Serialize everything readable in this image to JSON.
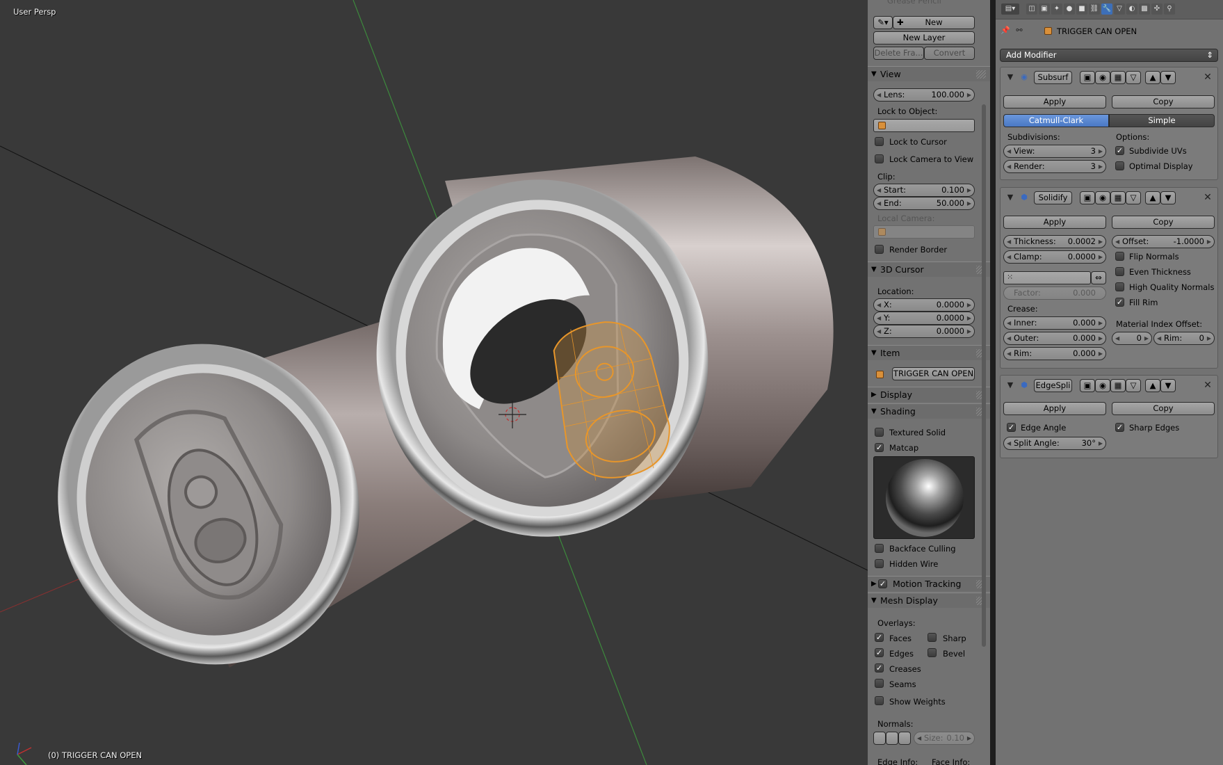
{
  "viewport": {
    "view_label": "User Persp",
    "object_label": "(0) TRIGGER CAN OPEN"
  },
  "tool_panel": {
    "grease_pencil": {
      "label": "Grease Pencil",
      "new": "New",
      "new_layer": "New Layer",
      "delete_frame": "Delete Fra...",
      "convert": "Convert"
    },
    "view": {
      "title": "View",
      "lens_label": "Lens:",
      "lens_value": "100.000",
      "lock_to_object": "Lock to Object:",
      "lock_to_cursor": "Lock to Cursor",
      "lock_camera": "Lock Camera to View",
      "clip": "Clip:",
      "start_label": "Start:",
      "start_value": "0.100",
      "end_label": "End:",
      "end_value": "50.000",
      "local_camera": "Local Camera:",
      "render_border": "Render Border"
    },
    "cursor": {
      "title": "3D Cursor",
      "location": "Location:",
      "x_label": "X:",
      "x_value": "0.0000",
      "y_label": "Y:",
      "y_value": "0.0000",
      "z_label": "Z:",
      "z_value": "0.0000"
    },
    "item": {
      "title": "Item",
      "name": "TRIGGER CAN OPEN"
    },
    "display": {
      "title": "Display"
    },
    "shading": {
      "title": "Shading",
      "textured_solid": "Textured Solid",
      "textured_solid_checked": false,
      "matcap": "Matcap",
      "matcap_checked": true,
      "backface_culling": "Backface Culling",
      "hidden_wire": "Hidden Wire"
    },
    "motion_tracking": {
      "title": "Motion Tracking",
      "checked": true
    },
    "mesh_display": {
      "title": "Mesh Display",
      "overlays": "Overlays:",
      "faces": "Faces",
      "faces_checked": true,
      "sharp": "Sharp",
      "sharp_checked": false,
      "edges": "Edges",
      "edges_checked": true,
      "bevel": "Bevel",
      "bevel_checked": false,
      "creases": "Creases",
      "creases_checked": true,
      "seams": "Seams",
      "seams_checked": false,
      "show_weights": "Show Weights",
      "show_weights_checked": false,
      "normals": "Normals:",
      "size_label": "Size:",
      "size_value": "0.10",
      "edge_info": "Edge Info:",
      "face_info": "Face Info:"
    }
  },
  "properties": {
    "object_name": "TRIGGER CAN OPEN",
    "add_modifier": "Add Modifier",
    "subsurf": {
      "name": "Subsurf",
      "apply": "Apply",
      "copy": "Copy",
      "catmull": "Catmull-Clark",
      "simple": "Simple",
      "subdivisions": "Subdivisions:",
      "options": "Options:",
      "view_label": "View:",
      "view_value": "3",
      "render_label": "Render:",
      "render_value": "3",
      "subdivide_uvs": "Subdivide UVs",
      "subdivide_uvs_checked": true,
      "optimal_display": "Optimal Display",
      "optimal_display_checked": false
    },
    "solidify": {
      "name": "Solidify",
      "apply": "Apply",
      "copy": "Copy",
      "thickness_label": "Thickness:",
      "thickness_value": "0.0002",
      "offset_label": "Offset:",
      "offset_value": "-1.0000",
      "clamp_label": "Clamp:",
      "clamp_value": "0.0000",
      "flip_normals": "Flip Normals",
      "even_thickness": "Even Thickness",
      "high_quality_normals": "High Quality Normals",
      "fill_rim": "Fill Rim",
      "fill_rim_checked": true,
      "factor_label": "Factor:",
      "factor_value": "0.000",
      "crease": "Crease:",
      "inner_label": "Inner:",
      "inner_value": "0.000",
      "outer_label": "Outer:",
      "outer_value": "0.000",
      "rim_label": "Rim:",
      "rim_value": "0.000",
      "material_index_offset": "Material Index Offset:",
      "mat_value": "0",
      "mat_rim_label": "Rim:",
      "mat_rim_value": "0"
    },
    "edgesplit": {
      "name": "EdgeSpli",
      "apply": "Apply",
      "copy": "Copy",
      "edge_angle": "Edge Angle",
      "edge_angle_checked": true,
      "sharp_edges": "Sharp Edges",
      "sharp_edges_checked": true,
      "split_angle_label": "Split Angle:",
      "split_angle_value": "30°"
    }
  },
  "colors": {
    "accent": "#5680c2",
    "selection": "#e8962a",
    "panel": "#727272",
    "viewport": "#393939"
  },
  "icons": [
    "pencil-icon",
    "plus-icon",
    "cube-icon",
    "wrench-icon",
    "eye-icon",
    "camera-icon",
    "close-icon",
    "arrow-up-icon",
    "arrow-down-icon",
    "pin-icon",
    "matcap-sphere"
  ]
}
